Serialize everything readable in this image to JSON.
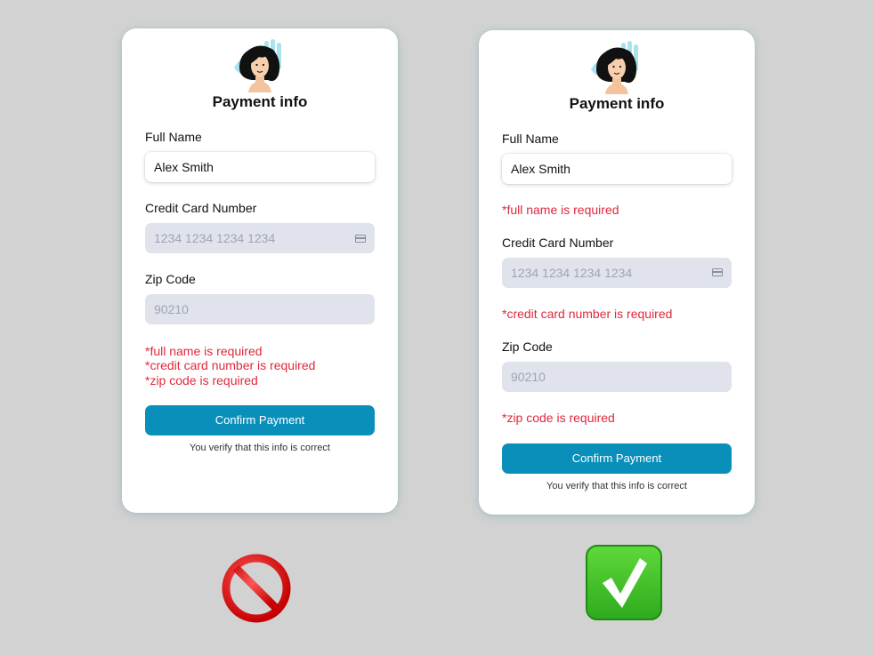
{
  "colors": {
    "page_background": "#d2d2d2",
    "card_background": "#ffffff",
    "accent_button": "#0a8fbb",
    "error_text": "#e0283c",
    "disabled_input": "#e1e3ec",
    "placeholder_text": "#9fa3b4"
  },
  "bad_example": {
    "title": "Payment info",
    "fields": {
      "full_name_label": "Full Name",
      "full_name_value": "Alex Smith",
      "card_label": "Credit Card Number",
      "card_placeholder": "1234 1234 1234 1234",
      "zip_label": "Zip Code",
      "zip_placeholder": "90210"
    },
    "errors": [
      "*full name is required",
      "*credit card number is required",
      "*zip code is required"
    ],
    "button_label": "Confirm Payment",
    "note": "You verify that this info is correct",
    "verdict_icon": "prohibited-icon"
  },
  "good_example": {
    "title": "Payment info",
    "fields": {
      "full_name_label": "Full Name",
      "full_name_value": "Alex Smith",
      "full_name_error": "*full name is required",
      "card_label": "Credit Card Number",
      "card_placeholder": "1234 1234 1234 1234",
      "card_error": "*credit card number is required",
      "zip_label": "Zip Code",
      "zip_placeholder": "90210",
      "zip_error": "*zip code is required"
    },
    "button_label": "Confirm Payment",
    "note": "You verify that this info is correct",
    "verdict_icon": "check-mark-icon"
  }
}
